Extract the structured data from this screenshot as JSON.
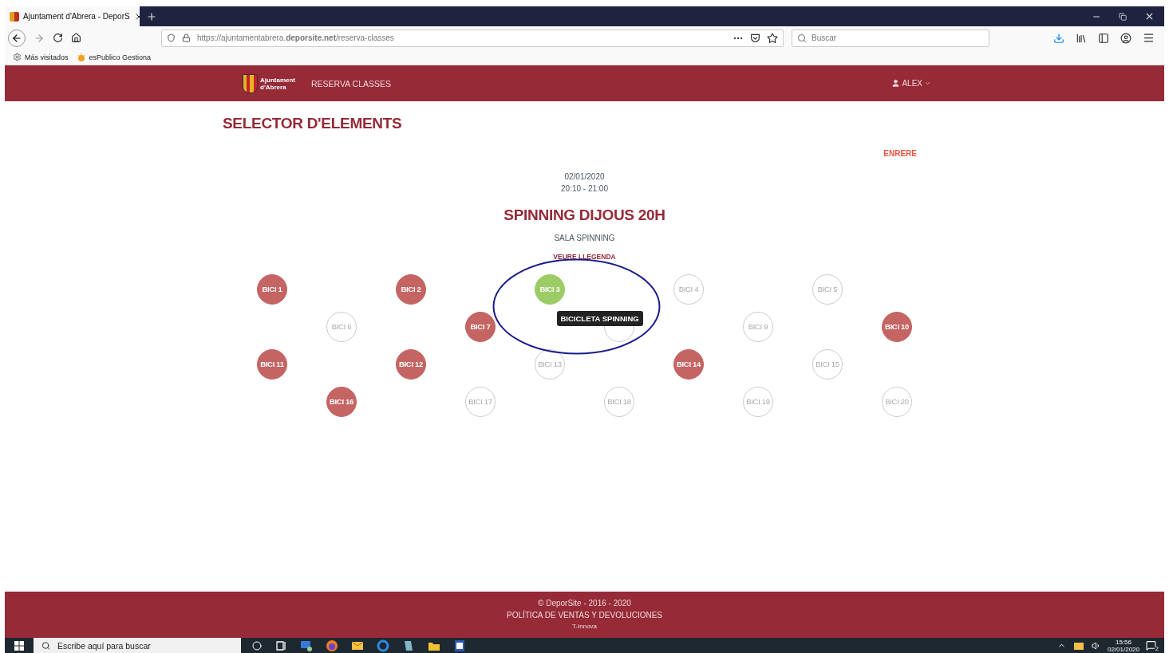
{
  "browser": {
    "tab_title": "Ajuntament d'Abrera - DeporS",
    "url": "https://ajuntamentabrera.**deporsite.net**/reserva-classes",
    "search_placeholder": "Buscar",
    "bookmarks": [
      "Más visitados",
      "esPublico Gestiona"
    ]
  },
  "header": {
    "logo_text": [
      "Ajuntament",
      "d'Abrera"
    ],
    "nav": [
      "RESERVA CLASSES"
    ],
    "user": "ALEX"
  },
  "page": {
    "title": "SELECTOR D'ELEMENTS",
    "back_link": "ENRERE",
    "date": "02/01/2020",
    "time": "20:10 - 21:00",
    "class_name": "SPINNING DIJOUS 20H",
    "room": "SALA SPINNING",
    "legend_link": "VEURE LLEGENDA"
  },
  "bikes": [
    {
      "label": "BICI 1",
      "occupied": true,
      "selected": false
    },
    {
      "label": "BICI 2",
      "occupied": true,
      "selected": false
    },
    {
      "label": "BICI 3",
      "occupied": false,
      "selected": true
    },
    {
      "label": "BICI 4",
      "occupied": false,
      "selected": false
    },
    {
      "label": "BICI 5",
      "occupied": false,
      "selected": false
    },
    {
      "label": "BICI 6",
      "occupied": false,
      "selected": false
    },
    {
      "label": "BICI 7",
      "occupied": true,
      "selected": false
    },
    {
      "occupied": false,
      "selected": false
    },
    {
      "label": "BICI 9",
      "occupied": false,
      "selected": false
    },
    {
      "label": "BICI 10",
      "occupied": true,
      "selected": false
    },
    {
      "label": "BICI 11",
      "occupied": true,
      "selected": false
    },
    {
      "label": "BICI 12",
      "occupied": true,
      "selected": false
    },
    {
      "label": "BICI 13",
      "occupied": false,
      "selected": false
    },
    {
      "label": "BICI 14",
      "occupied": true,
      "selected": false
    },
    {
      "label": "BICI 15",
      "occupied": false,
      "selected": false
    },
    {
      "label": "BICI 16",
      "occupied": true,
      "selected": false
    },
    {
      "label": "BICI 17",
      "occupied": false,
      "selected": false
    },
    {
      "label": "BICI 18",
      "occupied": false,
      "selected": false
    },
    {
      "label": "BICI 19",
      "occupied": false,
      "selected": false
    },
    {
      "label": "BICI 20",
      "occupied": false,
      "selected": false
    }
  ],
  "tooltip": "BICICLETA SPINNING",
  "footer": {
    "copyright": "© DeporSite - 2016 - 2020",
    "policy_link": "POLÍTICA DE VENTAS Y DEVOLUCIONES",
    "credit": "T-Innova"
  },
  "taskbar": {
    "search_placeholder": "Escribe aquí para buscar",
    "time": "15:56",
    "date": "02/01/2020",
    "notifications": "2"
  }
}
